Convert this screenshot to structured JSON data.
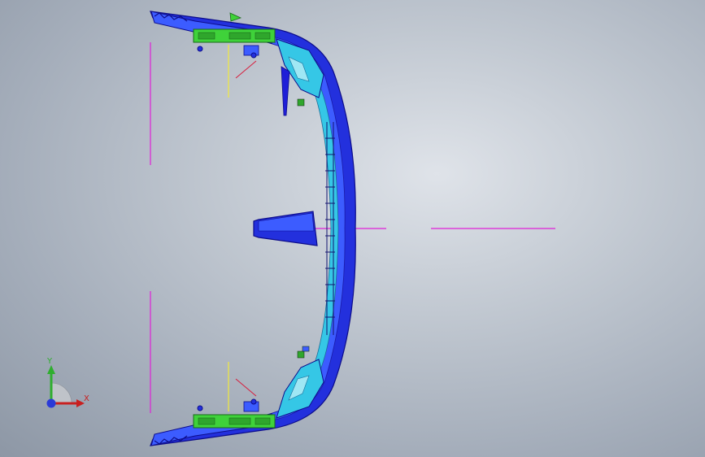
{
  "viewport": {
    "background_center": "#dfe3e9",
    "background_edge": "#8d97a5"
  },
  "model": {
    "name": "",
    "colors": {
      "body_dark_blue": "#1f1fd8",
      "body_mid_blue": "#2b4cff",
      "inner_cyan": "#35c7e6",
      "inner_light": "#9fe7f4",
      "brackets_green": "#3fd23a",
      "reference_magenta": "#e020d8",
      "reference_yellow": "#f2ea3a",
      "sketch_red": "#d81c3c"
    }
  },
  "triad": {
    "icon": "coordinate-triad-icon",
    "y_label": "Y",
    "x_label": "X",
    "y_color": "#2fae2f",
    "x_color": "#c82020",
    "z_color": "#2a3ad8"
  }
}
